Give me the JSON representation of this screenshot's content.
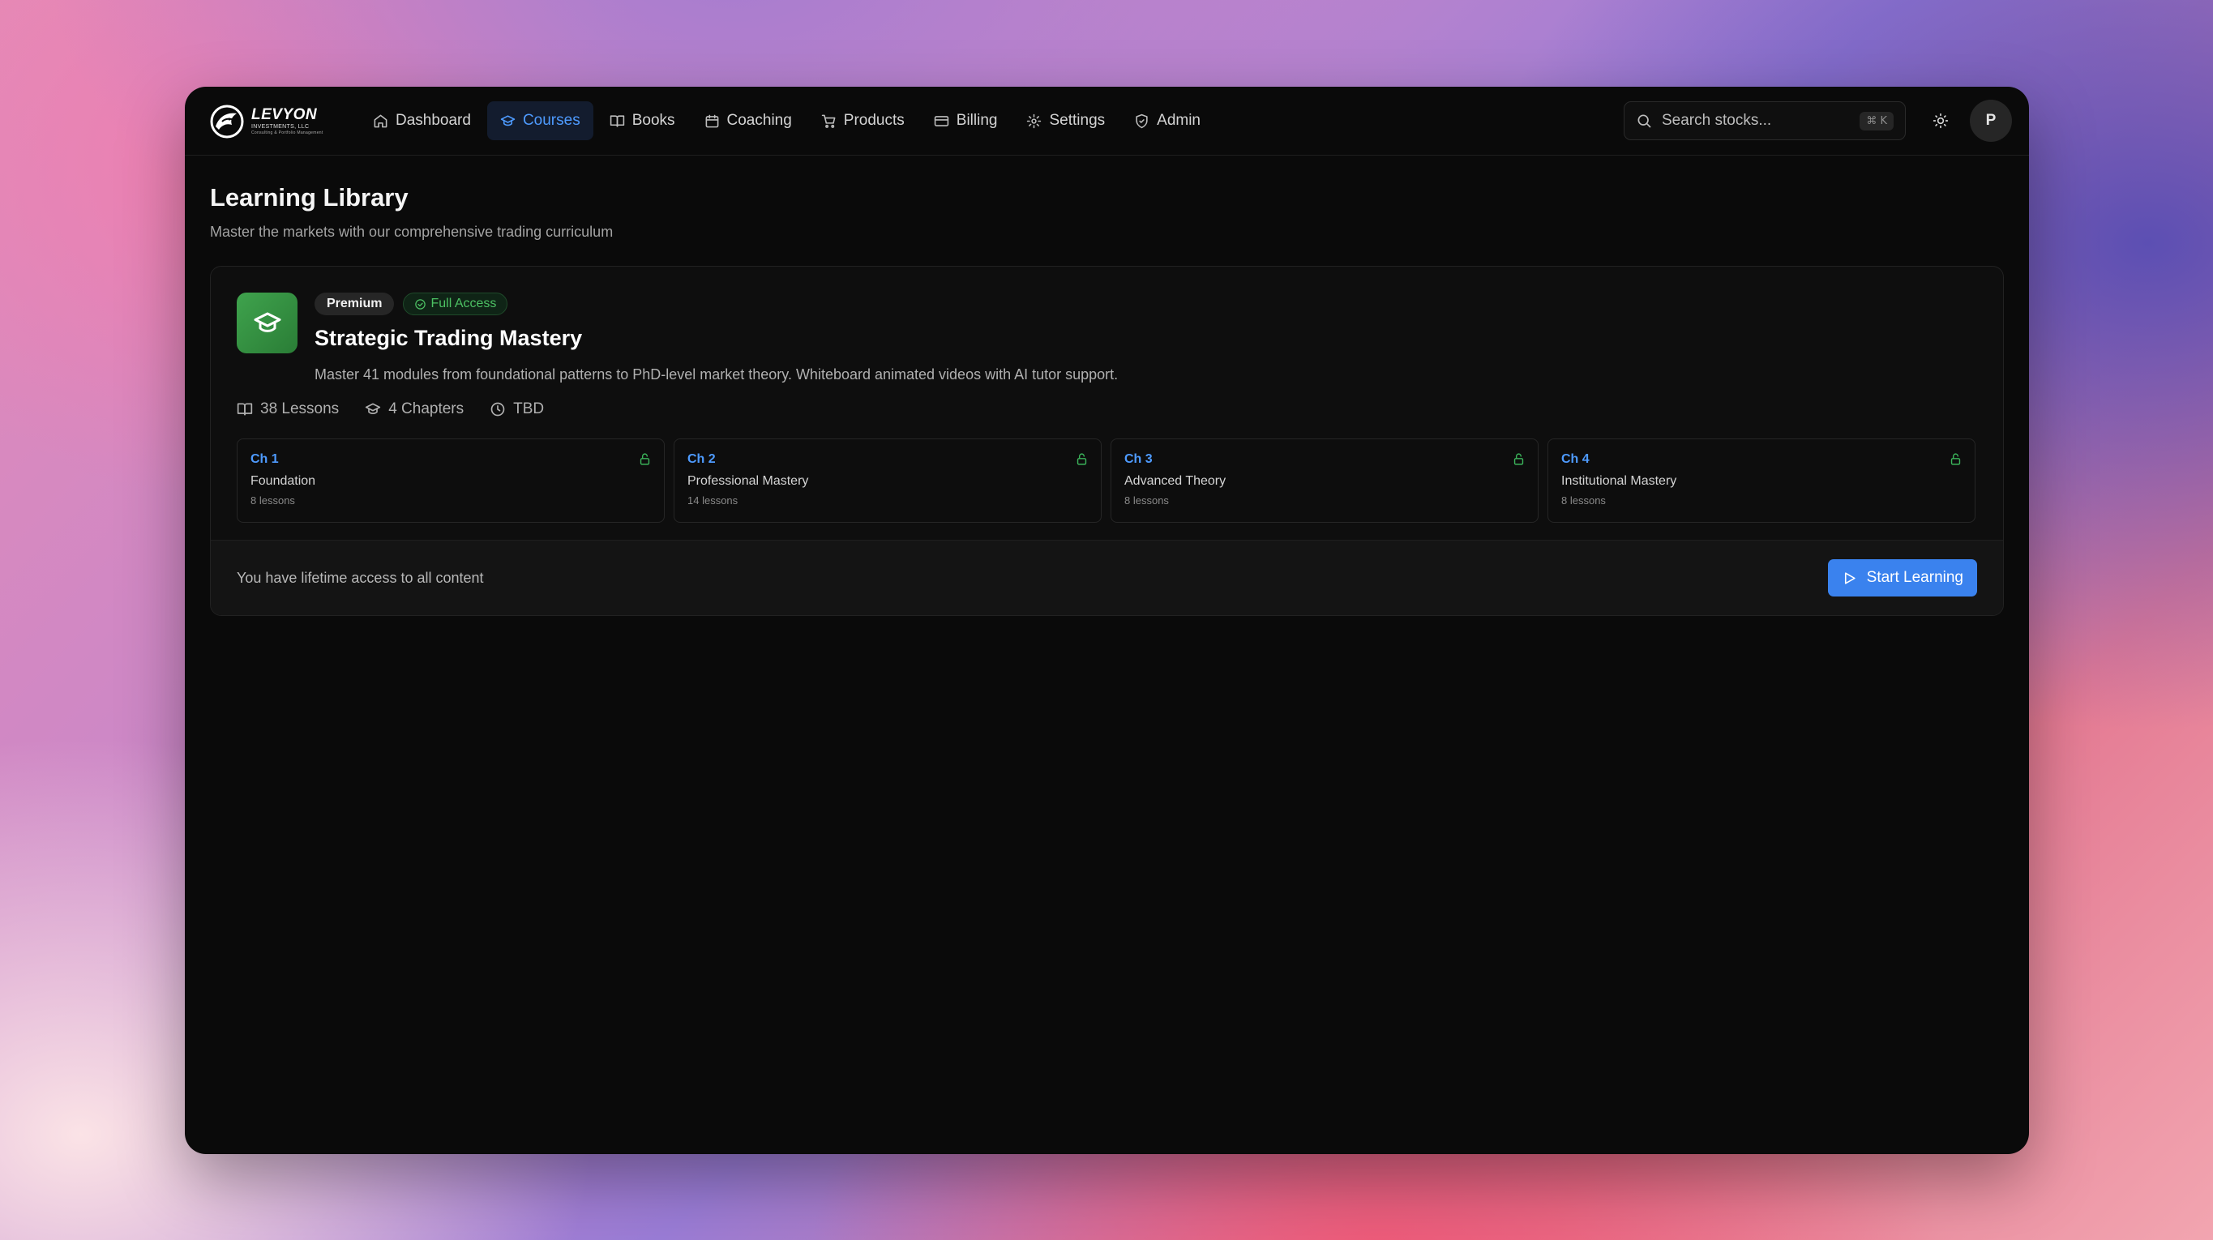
{
  "app": {
    "logo_name": "LEVYON",
    "logo_sub": "INVESTMENTS, LLC",
    "logo_tagline": "Consulting & Portfolio Management"
  },
  "nav": {
    "items": [
      {
        "label": "Dashboard",
        "icon": "home-icon"
      },
      {
        "label": "Courses",
        "icon": "graduation-cap-icon",
        "active": true
      },
      {
        "label": "Books",
        "icon": "book-icon"
      },
      {
        "label": "Coaching",
        "icon": "calendar-icon"
      },
      {
        "label": "Products",
        "icon": "cart-icon"
      },
      {
        "label": "Billing",
        "icon": "credit-card-icon"
      },
      {
        "label": "Settings",
        "icon": "gear-icon"
      },
      {
        "label": "Admin",
        "icon": "shield-icon"
      }
    ]
  },
  "search": {
    "placeholder": "Search stocks...",
    "shortcut": "⌘ K"
  },
  "user": {
    "avatar_initial": "P"
  },
  "page": {
    "title": "Learning Library",
    "subtitle": "Master the markets with our comprehensive trading curriculum"
  },
  "course": {
    "badge_premium": "Premium",
    "badge_access": "Full Access",
    "title": "Strategic Trading Mastery",
    "description": "Master 41 modules from foundational patterns to PhD-level market theory. Whiteboard animated videos with AI tutor support.",
    "meta": {
      "lessons": "38 Lessons",
      "chapters": "4 Chapters",
      "duration": "TBD"
    },
    "chapter_list": [
      {
        "num": "Ch 1",
        "name": "Foundation",
        "count": "8 lessons"
      },
      {
        "num": "Ch 2",
        "name": "Professional Mastery",
        "count": "14 lessons"
      },
      {
        "num": "Ch 3",
        "name": "Advanced Theory",
        "count": "8 lessons"
      },
      {
        "num": "Ch 4",
        "name": "Institutional Mastery",
        "count": "8 lessons"
      }
    ],
    "footer_text": "You have lifetime access to all content",
    "cta_label": "Start Learning"
  },
  "colors": {
    "accent": "#3a82ee",
    "active_nav_text": "#4e9bff",
    "success": "#4cc063",
    "course_icon": "#3fa34d"
  }
}
